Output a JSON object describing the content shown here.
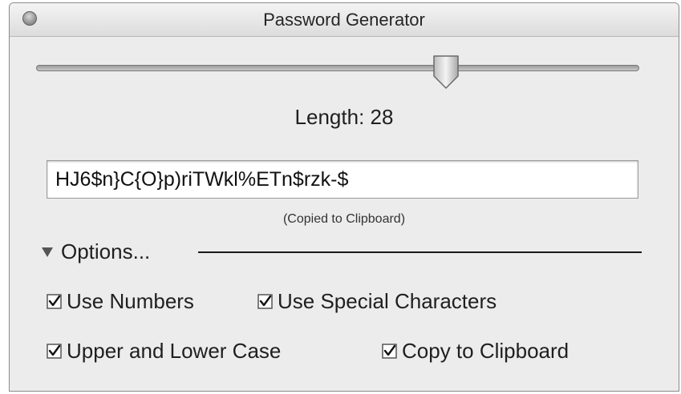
{
  "window": {
    "title": "Password Generator"
  },
  "length": {
    "label": "Length: 28",
    "value": 28,
    "slider_fraction": 0.68
  },
  "password": {
    "value": "HJ6$n}C{O}p)riTWkl%ETn$rzk-$"
  },
  "copied_note": "(Copied to Clipboard)",
  "options": {
    "label": "Options...",
    "expanded": true,
    "checkboxes": [
      {
        "label": "Use Numbers",
        "checked": true
      },
      {
        "label": "Use Special Characters",
        "checked": true
      },
      {
        "label": "Upper and Lower Case",
        "checked": true
      },
      {
        "label": "Copy to Clipboard",
        "checked": true
      }
    ]
  }
}
